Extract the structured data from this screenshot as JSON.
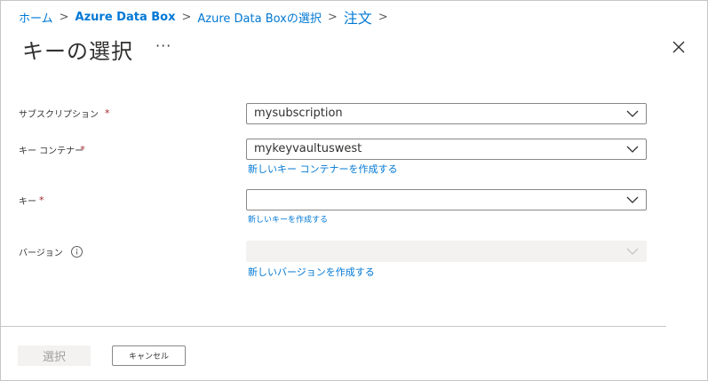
{
  "breadcrumb": {
    "items": [
      "ホーム",
      "Azure Data Box",
      "Azure Data Boxの選択",
      "注文"
    ],
    "separator": ">"
  },
  "header": {
    "title": "キーの選択",
    "more_label": "···"
  },
  "form": {
    "subscription": {
      "label": "サブスクリプション",
      "required_mark": "*",
      "value": "mysubscription"
    },
    "key_vault": {
      "label": "キー コンテナー",
      "required_mark": "*",
      "value": "mykeyvaultuswest",
      "create_link": "新しいキー コンテナーを作成する"
    },
    "key": {
      "label": "キー",
      "required_mark": "*",
      "value": "",
      "create_link": "新しいキーを作成する"
    },
    "version": {
      "label": "バージョン",
      "value": "",
      "create_link": "新しいバージョンを作成する"
    }
  },
  "footer": {
    "select_label": "選択",
    "cancel_label": "キャンセル"
  },
  "colors": {
    "link": "#0078d4",
    "required": "#a4262c",
    "border": "#8a8886",
    "disabled_bg": "#f3f2f1"
  },
  "icons": [
    "chevron-down-icon",
    "close-icon",
    "info-icon",
    "more-icon"
  ]
}
